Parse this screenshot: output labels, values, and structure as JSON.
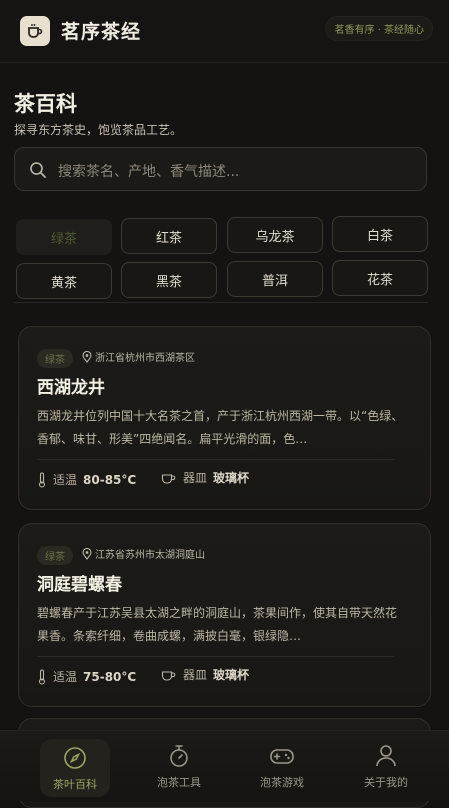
{
  "app": {
    "title": "茗序茶经",
    "tagline": "茗香有序 · 茶经随心"
  },
  "header": {
    "title": "茶百科",
    "subtitle": "探寻东方茶史，饱览茶品工艺。"
  },
  "search": {
    "placeholder": "搜索茶名、产地、香气描述..."
  },
  "filters": [
    "绿茶",
    "红茶",
    "乌龙茶",
    "白茶",
    "黄茶",
    "黑茶",
    "普洱",
    "花茶"
  ],
  "active_filter": "绿茶",
  "cards": [
    {
      "badge": "绿茶",
      "location": "浙江省杭州市西湖茶区",
      "name": "西湖龙井",
      "desc": "西湖龙井位列中国十大名茶之首，产于浙江杭州西湖一带。以“色绿、香郁、味甘、形美”四绝闻名。扁平光滑的面，色…",
      "temp_label": "适温",
      "temp": "80-85°C",
      "vessel_label": "器皿",
      "vessel": "玻璃杯"
    },
    {
      "badge": "绿茶",
      "location": "江苏省苏州市太湖洞庭山",
      "name": "洞庭碧螺春",
      "desc": "碧螺春产于江苏吴县太湖之畔的洞庭山，茶果间作，使其自带天然花果香。条索纤细，卷曲成螺，满披白毫，银绿隐…",
      "temp_label": "适温",
      "temp": "75-80°C",
      "vessel_label": "器皿",
      "vessel": "玻璃杯"
    }
  ],
  "nav": [
    {
      "label": "茶叶百科",
      "icon": "compass-icon"
    },
    {
      "label": "泡茶工具",
      "icon": "stopwatch-icon"
    },
    {
      "label": "泡茶游戏",
      "icon": "gamepad-icon"
    },
    {
      "label": "关于我的",
      "icon": "user-icon"
    }
  ],
  "colors": {
    "accent": "#9ca563",
    "background": "#141311",
    "card": "#1c1a16"
  }
}
